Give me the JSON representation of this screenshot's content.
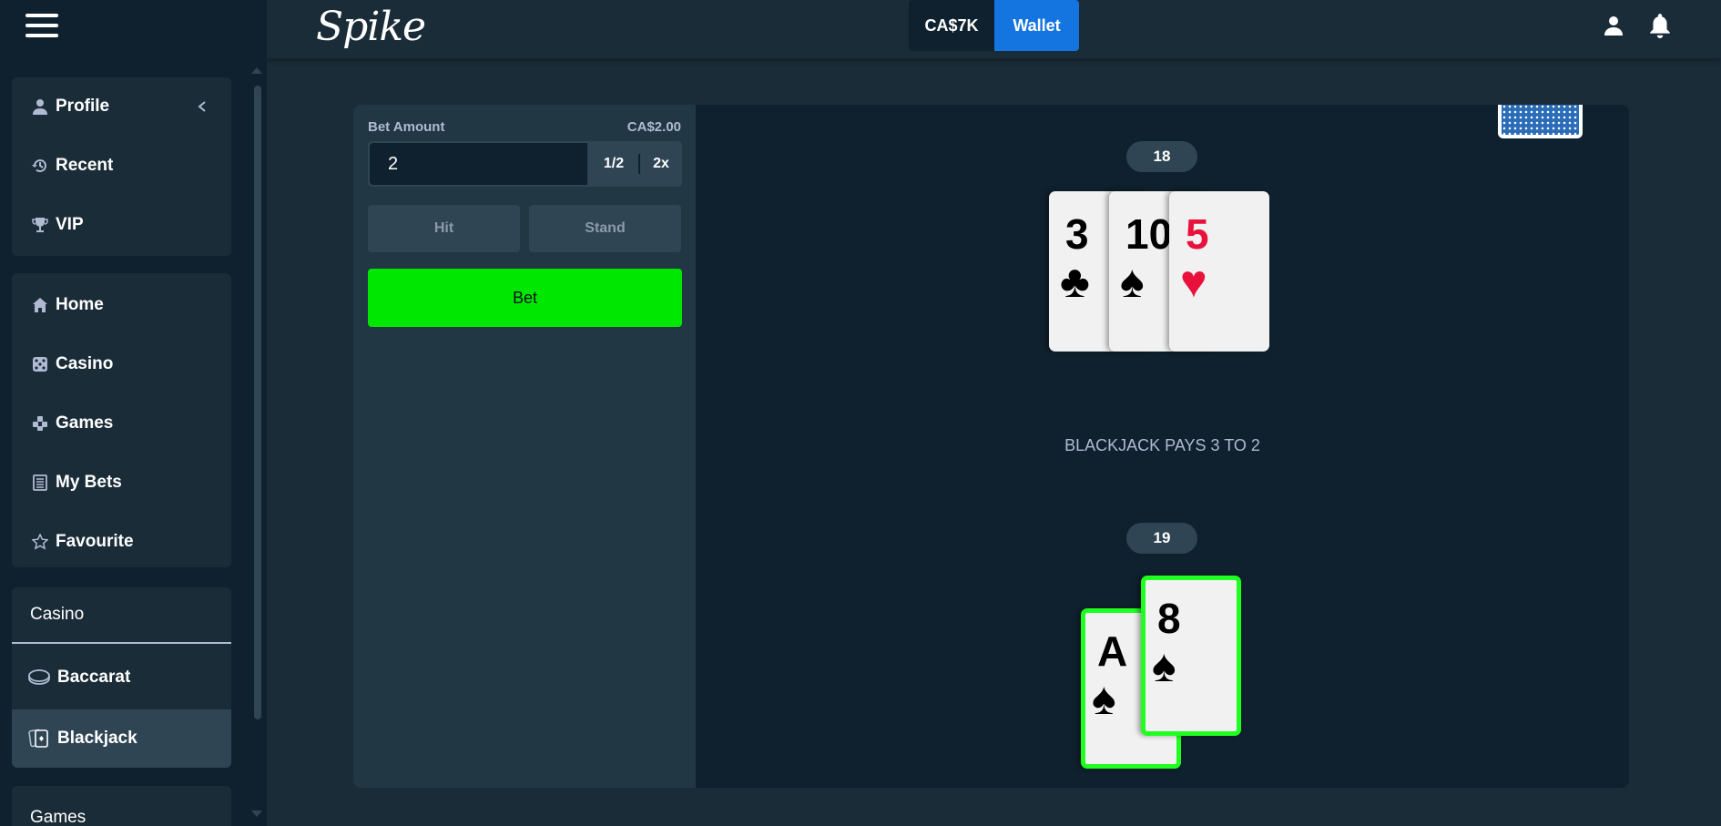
{
  "topbar": {
    "logo": "Spike",
    "balance": "CA$7K",
    "wallet_label": "Wallet"
  },
  "sidebar": {
    "group1": [
      {
        "label": "Profile",
        "icon": "person-icon"
      },
      {
        "label": "Recent",
        "icon": "history-icon"
      },
      {
        "label": "VIP",
        "icon": "trophy-icon"
      }
    ],
    "group2": [
      {
        "label": "Home",
        "icon": "home-icon"
      },
      {
        "label": "Casino",
        "icon": "dice-icon"
      },
      {
        "label": "Games",
        "icon": "gamepad-icon"
      },
      {
        "label": "My Bets",
        "icon": "receipt-icon"
      },
      {
        "label": "Favourite",
        "icon": "star-icon"
      }
    ],
    "casino_header": "Casino",
    "casino_items": [
      {
        "label": "Baccarat",
        "icon": "baccarat-icon"
      },
      {
        "label": "Blackjack",
        "icon": "cards-icon",
        "active": true
      }
    ],
    "games_header": "Games"
  },
  "bet_panel": {
    "bet_amount_label": "Bet Amount",
    "bet_amount_value": "CA$2.00",
    "bet_input_value": "2",
    "half_label": "1/2",
    "double_label": "2x",
    "hit_label": "Hit",
    "stand_label": "Stand",
    "bet_label": "Bet"
  },
  "table": {
    "dealer_score": "18",
    "dealer_cards": [
      {
        "rank": "3",
        "suit": "♣",
        "color": "#000000"
      },
      {
        "rank": "10",
        "suit": "♠",
        "color": "#000000"
      },
      {
        "rank": "5",
        "suit": "♥",
        "color": "#e9113c"
      }
    ],
    "banner": "BLACKJACK PAYS 3 TO 2",
    "player_score": "19",
    "player_cards": [
      {
        "rank": "A",
        "suit": "♠",
        "color": "#000000"
      },
      {
        "rank": "8",
        "suit": "♠",
        "color": "#000000"
      }
    ],
    "win_outline_color": "#1fff20"
  },
  "colors": {
    "bet_button": "#00e701",
    "wallet_button": "#1475e1",
    "background": "#1a2c38",
    "panel": "#213743",
    "table": "#0f212e"
  }
}
